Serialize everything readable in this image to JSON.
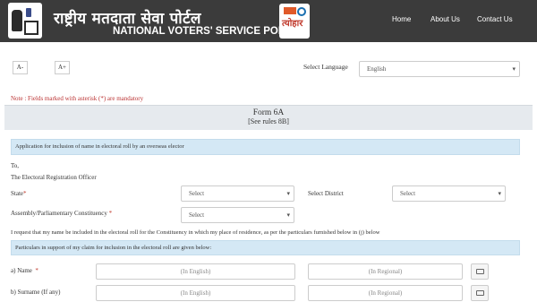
{
  "header": {
    "title_hindi": "राष्ट्रीय मतदाता सेवा पोर्टल",
    "title_english": "NATIONAL VOTERS' SERVICE PORTAL",
    "left_logo_icon": "voter-hand-ballot-logo",
    "right_logo_icon": "election-festival-logo",
    "right_logo_text": "त्योहार",
    "nav": {
      "home": "Home",
      "about": "About Us",
      "contact": "Contact Us"
    },
    "background_color": "#3b3b3b"
  },
  "toolbar": {
    "font_decrease": "A-",
    "font_increase": "A+",
    "language_label": "Select Language",
    "language_value": "English"
  },
  "note": "Note : Fields marked with asterisk (*) are mandatory",
  "form": {
    "title": "Form 6A",
    "subtitle": "[See rules 8B]",
    "application_band": "Application for inclusion of name in electoral roll by an overseas elector",
    "to_label": "To,",
    "recipient": "The Electoral Registration Officer",
    "state_label": "State",
    "state_value": "Select",
    "district_label": "Select District",
    "district_value": "Select",
    "assembly_label": "Assembly/Parliamentary Constituency",
    "assembly_value": "Select",
    "request_text": "I request that my name be included in the electoral roll for the Constituency in which my place of residence, as per the particulars furnished below in (j) below",
    "particulars_band": "Particulars in support of my claim for inclusion in the electoral roll are given below:",
    "asterisk": "*",
    "rows": [
      {
        "label": "a) Name",
        "required": true,
        "english_placeholder": "(In English)",
        "regional_placeholder": "(In Regional)"
      },
      {
        "label": "b) Surname (If any)",
        "required": false,
        "english_placeholder": "(In English)",
        "regional_placeholder": "(In Regional)"
      }
    ],
    "accent_color": "#d4e8f5",
    "required_color": "#c0392b"
  }
}
